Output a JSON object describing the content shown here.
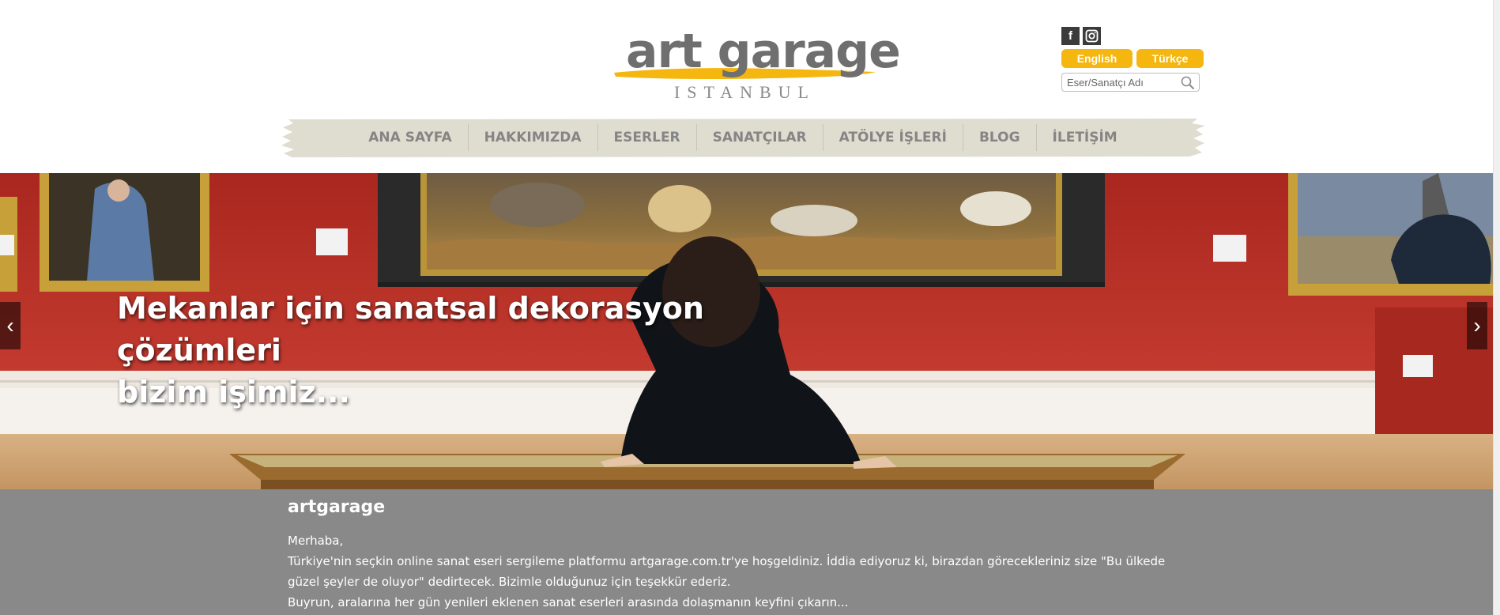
{
  "brand": {
    "logo_main": "art garage",
    "logo_sub": "ISTANBUL",
    "accent_color": "#f5b60f"
  },
  "social": [
    {
      "icon": "facebook-icon",
      "glyph": "f"
    },
    {
      "icon": "instagram-icon",
      "glyph": ""
    }
  ],
  "languages": {
    "english": "English",
    "turkish": "Türkçe"
  },
  "search": {
    "placeholder": "Eser/Sanatçı Adı",
    "icon": "search-icon"
  },
  "nav": {
    "items": [
      "ANA SAYFA",
      "HAKKIMIZDA",
      "ESERLER",
      "SANATÇILAR",
      "ATÖLYE İŞLERİ",
      "BLOG",
      "İLETİŞİM"
    ]
  },
  "hero": {
    "caption_line1": "Mekanlar için sanatsal dekorasyon çözümleri",
    "caption_line2": "bizim işimiz...",
    "prev_arrow": "‹",
    "next_arrow": "›"
  },
  "intro": {
    "title": "artgarage",
    "paragraphs": [
      "Merhaba,",
      "Türkiye'nin seçkin online sanat eseri sergileme platformu artgarage.com.tr'ye hoşgeldiniz. İddia ediyoruz ki, birazdan görecekleriniz size \"Bu ülkede güzel şeyler de oluyor\" dedirtecek. Bizimle olduğunuz için teşekkür ederiz.",
      "Buyrun, aralarına her gün yenileri eklenen sanat eserleri arasında dolaşmanın keyfini çıkarın..."
    ]
  }
}
